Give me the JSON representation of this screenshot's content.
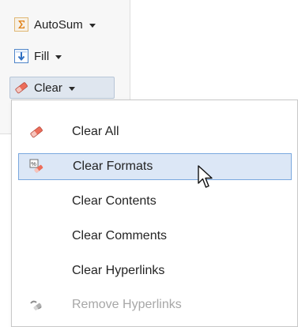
{
  "ribbon": {
    "autosum_label": "AutoSum",
    "fill_label": "Fill",
    "clear_label": "Clear"
  },
  "menu": {
    "items": [
      {
        "label": "Clear All",
        "icon": "eraser-icon",
        "state": "normal"
      },
      {
        "label": "Clear Formats",
        "icon": "clear-formats-icon",
        "state": "hover"
      },
      {
        "label": "Clear Contents",
        "icon": "",
        "state": "normal"
      },
      {
        "label": "Clear Comments",
        "icon": "",
        "state": "normal"
      },
      {
        "label": "Clear Hyperlinks",
        "icon": "",
        "state": "normal"
      },
      {
        "label": "Remove Hyperlinks",
        "icon": "link-remove-icon",
        "state": "disabled"
      }
    ]
  },
  "colors": {
    "ribbon_bg": "#f7f7f7",
    "pressed_bg": "#dfe6ef",
    "hover_bg": "#dce7f6",
    "hover_border": "#7aa8df",
    "disabled_text": "#a7a7a7",
    "menu_border": "#c8c8c8"
  }
}
